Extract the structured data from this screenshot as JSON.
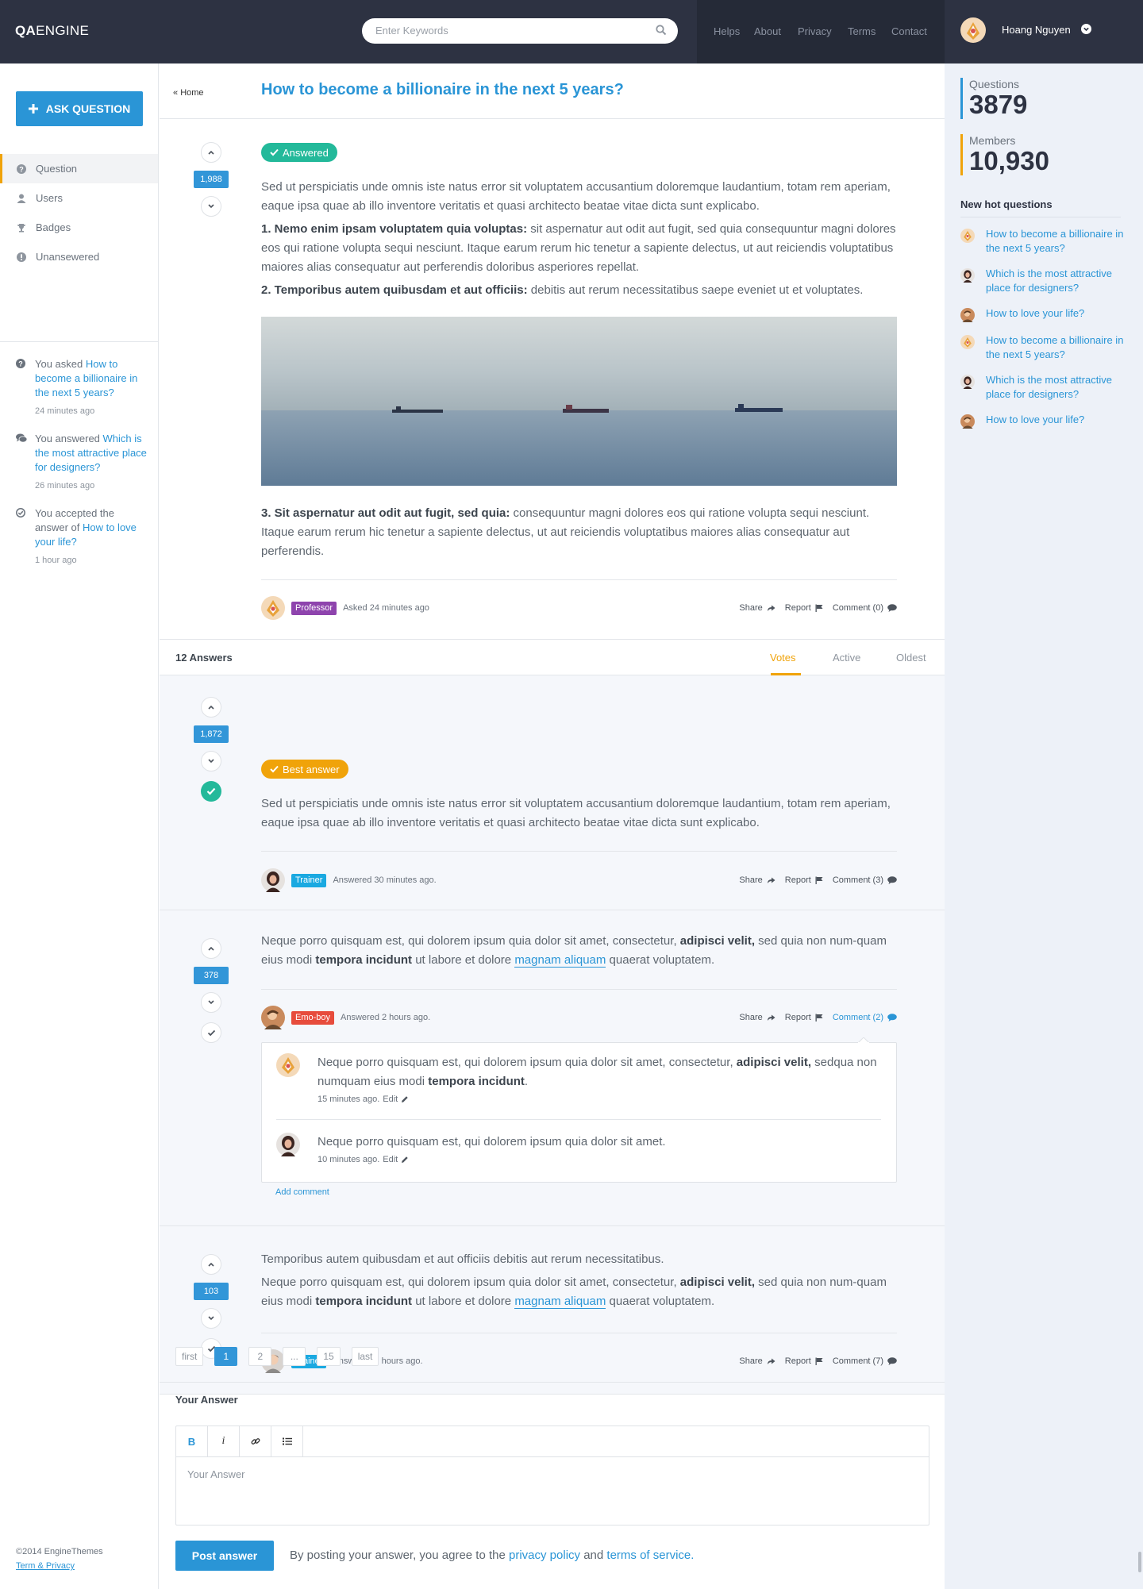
{
  "brand": {
    "logo_bold": "QA",
    "logo_rest": "ENGINE"
  },
  "search": {
    "placeholder": "Enter Keywords"
  },
  "topnav": [
    "Helps",
    "About",
    "Privacy",
    "Terms",
    "Contact"
  ],
  "user": {
    "name": "Hoang Nguyen"
  },
  "left": {
    "ask_button": "ASK QUESTION",
    "menu": [
      "Question",
      "Users",
      "Badges",
      "Unansewered"
    ],
    "activity": [
      {
        "prefix": "You asked ",
        "link": "How to become a billionaire in the next 5 years?",
        "time": "24 minutes ago"
      },
      {
        "prefix": "You answered ",
        "link": "Which is the most attractive place for designers?",
        "time": "26 minutes ago"
      },
      {
        "prefix": "You accepted the answer of ",
        "link": "How to love your life?",
        "time": "1 hour ago"
      }
    ],
    "footer_copy": "©2014 EngineThemes",
    "footer_link": "Term & Privacy"
  },
  "question": {
    "breadcrumb": "Home",
    "title": "How to become a billionaire in the next 5 years?",
    "votes": "1,988",
    "status": "Answered",
    "p1": "Sed ut perspiciatis unde omnis iste natus error sit voluptatem accusantium doloremque laudantium, totam rem aperiam, eaque ipsa quae ab illo inventore veritatis et quasi architecto beatae vitae dicta sunt explicabo.",
    "p2_bold": "1. Nemo enim ipsam voluptatem quia voluptas:",
    "p2": " sit aspernatur aut odit aut fugit, sed quia consequuntur magni dolores eos qui ratione volupta sequi nesciunt. Itaque earum rerum hic tenetur a sapiente delectus, ut aut reiciendis voluptatibus maiores alias consequatur aut perferendis doloribus asperiores repellat.",
    "p3_bold": "2. Temporibus autem quibusdam et aut officiis:",
    "p3": " debitis aut rerum necessitatibus saepe eveniet ut et voluptates.",
    "p4_bold": "3. Sit aspernatur aut odit aut fugit, sed quia:",
    "p4": " consequuntur magni dolores eos qui ratione volupta sequi nesciunt. Itaque earum rerum hic tenetur a sapiente delectus, ut aut reiciendis voluptatibus maiores alias consequatur aut perferendis.",
    "role": "Professor",
    "role_color": "#8e44ad",
    "time": "Asked 24 minutes ago",
    "share": "Share",
    "report": "Report",
    "comment": "Comment (0)"
  },
  "answers_bar": {
    "count": "12 Answers",
    "sorts": [
      "Votes",
      "Active",
      "Oldest"
    ]
  },
  "answers": [
    {
      "best_label": "Best answer",
      "votes": "1,872",
      "text": "Sed ut perspiciatis unde omnis iste natus error sit voluptatem accusantium doloremque laudantium, totam rem aperiam, eaque ipsa quae ab illo inventore veritatis et quasi architecto beatae vitae dicta sunt explicabo.",
      "role": "Trainer",
      "role_color": "#1aa9e1",
      "time": "Answered 30 minutes ago.",
      "share": "Share",
      "report": "Report",
      "comment": "Comment (3)"
    },
    {
      "votes": "378",
      "t1": "Neque porro quisquam est, qui dolorem ipsum quia dolor sit amet, consectetur, ",
      "t1_bold": "adipisci velit,",
      "t2": " sed quia non num-quam eius modi ",
      "t2_bold": "tempora incidunt",
      "t3": " ut labore et dolore ",
      "t3_link": "magnam aliquam",
      "t4": " quaerat voluptatem.",
      "role": "Emo-boy",
      "role_color": "#e74c3c",
      "time": "Answered 2 hours ago.",
      "share": "Share",
      "report": "Report",
      "comment": "Comment (2)",
      "comments": [
        {
          "t1": "Neque porro quisquam est, qui dolorem ipsum quia dolor sit amet, consectetur, ",
          "t1_bold": "adipisci velit,",
          "t2": " sedqua non numquam eius modi ",
          "t2_bold": "tempora incidunt",
          "t3": ".",
          "time": "15 minutes ago.",
          "edit": "Edit"
        },
        {
          "t1": "Neque porro quisquam est, qui dolorem ipsum quia dolor sit amet.",
          "time": "10 minutes ago.",
          "edit": "Edit"
        }
      ],
      "add_comment": "Add comment"
    },
    {
      "votes": "103",
      "t0": "Temporibus autem quibusdam et aut officiis debitis aut rerum necessitatibus.",
      "t1": "Neque porro quisquam est, qui dolorem ipsum quia dolor sit amet, consectetur, ",
      "t1_bold": "adipisci velit,",
      "t2": " sed quia non num-quam eius modi ",
      "t2_bold": "tempora incidunt",
      "t3": " ut labore et dolore ",
      "t3_link": "magnam aliquam",
      "t4": " quaerat voluptatem.",
      "role": "Trainer",
      "role_color": "#1aa9e1",
      "time": "Answered 3 hours ago.",
      "share": "Share",
      "report": "Report",
      "comment": "Comment (7)"
    }
  ],
  "pagination": [
    "first",
    "1",
    "2",
    "...",
    "15",
    "last"
  ],
  "your_answer": {
    "title": "Your Answer",
    "toolbar": [
      "B",
      "i",
      "link-icon",
      "list-icon"
    ],
    "placeholder": "Your Answer",
    "post": "Post answer",
    "agree_prefix": "By posting your answer, you agree to the ",
    "privacy": "privacy policy",
    "and": " and ",
    "terms": "terms of service."
  },
  "right": {
    "stats": [
      {
        "label": "Questions",
        "value": "3879",
        "color": "#2a95d6"
      },
      {
        "label": "Members",
        "value": "10,930",
        "color": "#f0a30a"
      }
    ],
    "hot_title": "New hot questions",
    "hot": [
      "How to become a billionaire in the next 5 years?",
      "Which is the most attractive place for designers?",
      "How to love your life?",
      "How to become a billionaire in the next 5 years?",
      "Which is the most attractive place for designers?",
      "How to love your life?"
    ]
  },
  "colors": {
    "accent": "#2a95d6",
    "header": "#2d3242",
    "green": "#23b99a",
    "orange": "#f0a30a"
  }
}
